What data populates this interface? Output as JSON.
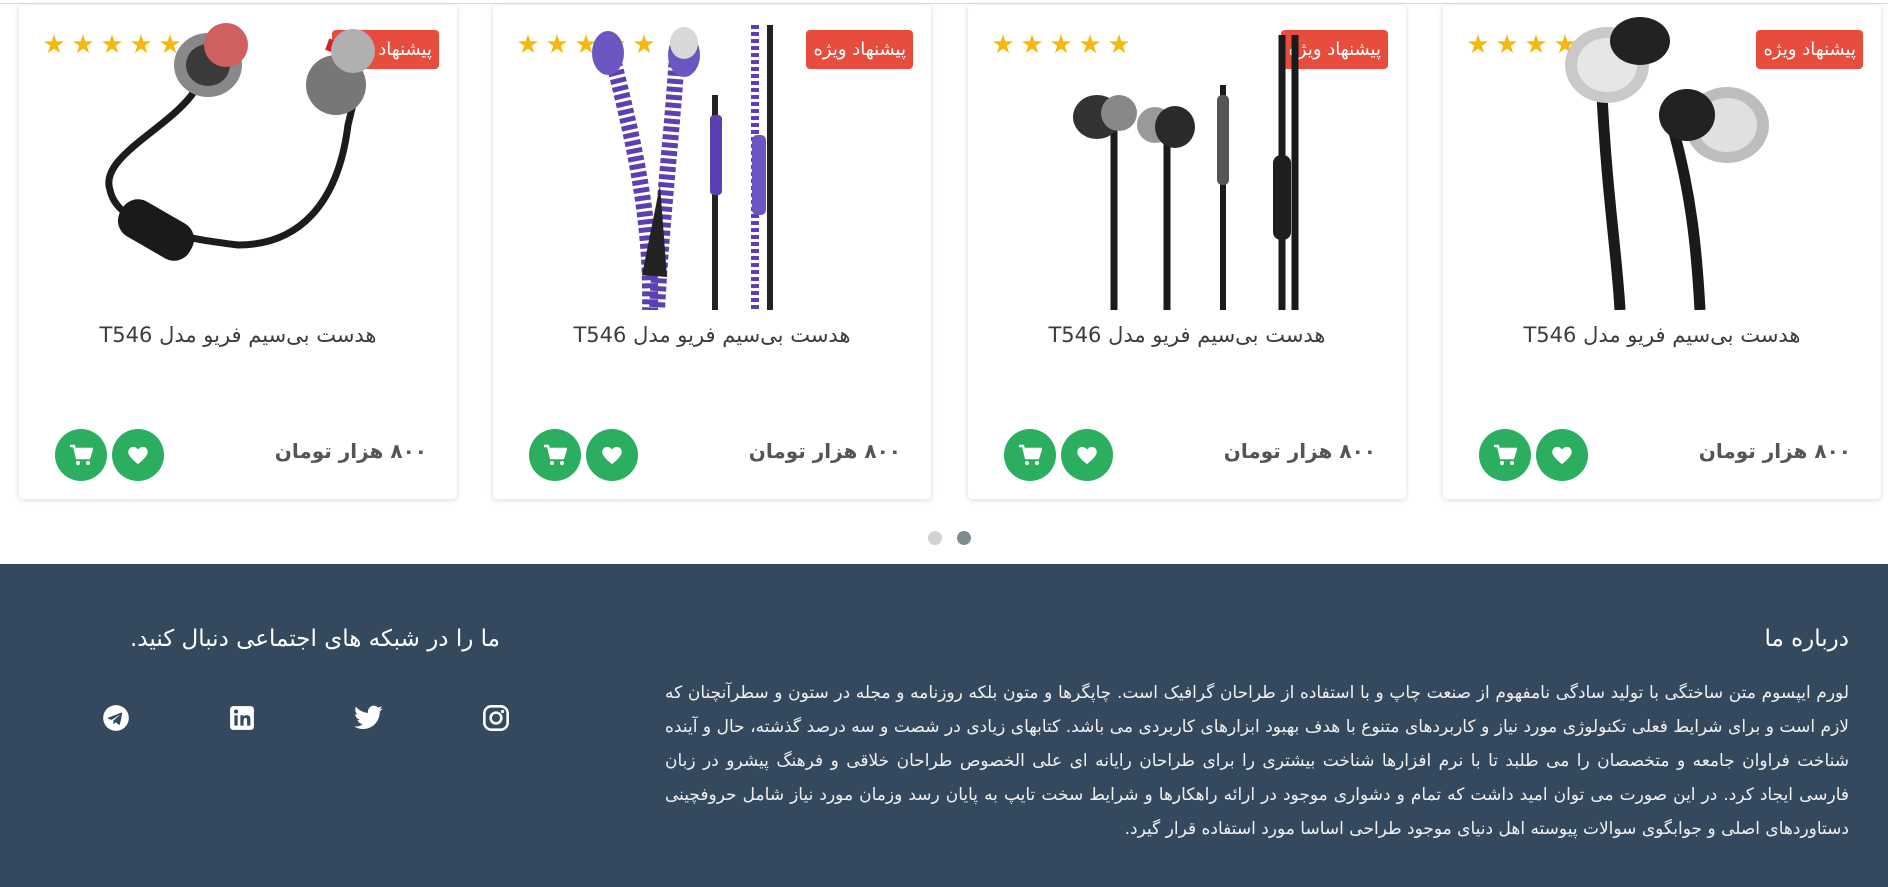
{
  "products": [
    {
      "badge": "پیشنهاد ویژه",
      "title": "هدست بی‌سیم فریو مدل T546",
      "price": "۸۰۰ هزار تومان",
      "rating": 5,
      "image": "silver-earbuds"
    },
    {
      "badge": "پیشنهاد ویژه",
      "title": "هدست بی‌سیم فریو مدل T546",
      "price": "۸۰۰ هزار تومان",
      "rating": 5,
      "image": "black-earphones-remote"
    },
    {
      "badge": "پیشنهاد ویژه",
      "title": "هدست بی‌سیم فریو مدل T546",
      "price": "۸۰۰ هزار تومان",
      "rating": 5,
      "image": "purple-zipper-earphones"
    },
    {
      "badge": "پیشنهاد ویژه",
      "title": "هدست بی‌سیم فریو مدل T546",
      "price": "۸۰۰ هزار تومان",
      "rating": 5,
      "image": "wireless-neckband-earphones"
    }
  ],
  "icons": {
    "star": "star-icon",
    "cart": "cart-icon",
    "heart": "heart-icon"
  },
  "carousel": {
    "pages": 2,
    "active_page": 2
  },
  "footer": {
    "about_title": "درباره ما",
    "about_text": "لورم ایپسوم متن ساختگی با تولید سادگی نامفهوم از صنعت چاپ و با استفاده از طراحان گرافیک است. چاپگرها و متون بلکه روزنامه و مجله در ستون و سطرآنچنان که لازم است و برای شرایط فعلی تکنولوژی مورد نیاز و کاربردهای متنوع با هدف بهبود ابزارهای کاربردی می باشد. کتابهای زیادی در شصت و سه درصد گذشته، حال و آینده شناخت فراوان جامعه و متخصصان را می طلبد تا با نرم افزارها شناخت بیشتری را برای طراحان رایانه ای علی الخصوص طراحان خلاقی و فرهنگ پیشرو در زبان فارسی ایجاد کرد. در این صورت می توان امید داشت که تمام و دشواری موجود در ارائه راهکارها و شرایط سخت تایپ به پایان رسد وزمان مورد نیاز شامل حروفچینی دستاوردهای اصلی و جوابگوی سوالات پیوسته اهل دنیای موجود طراحی اساسا مورد استفاده قرار گیرد.",
    "social_title": "ما را در شبکه های اجتماعی دنبال کنید.",
    "social_icons": [
      "instagram-icon",
      "twitter-icon",
      "linkedin-icon",
      "telegram-icon"
    ]
  },
  "colors": {
    "badge": "#e74c3c",
    "action": "#2bae5f",
    "star": "#f5b811",
    "footer_bg": "#34495e"
  }
}
